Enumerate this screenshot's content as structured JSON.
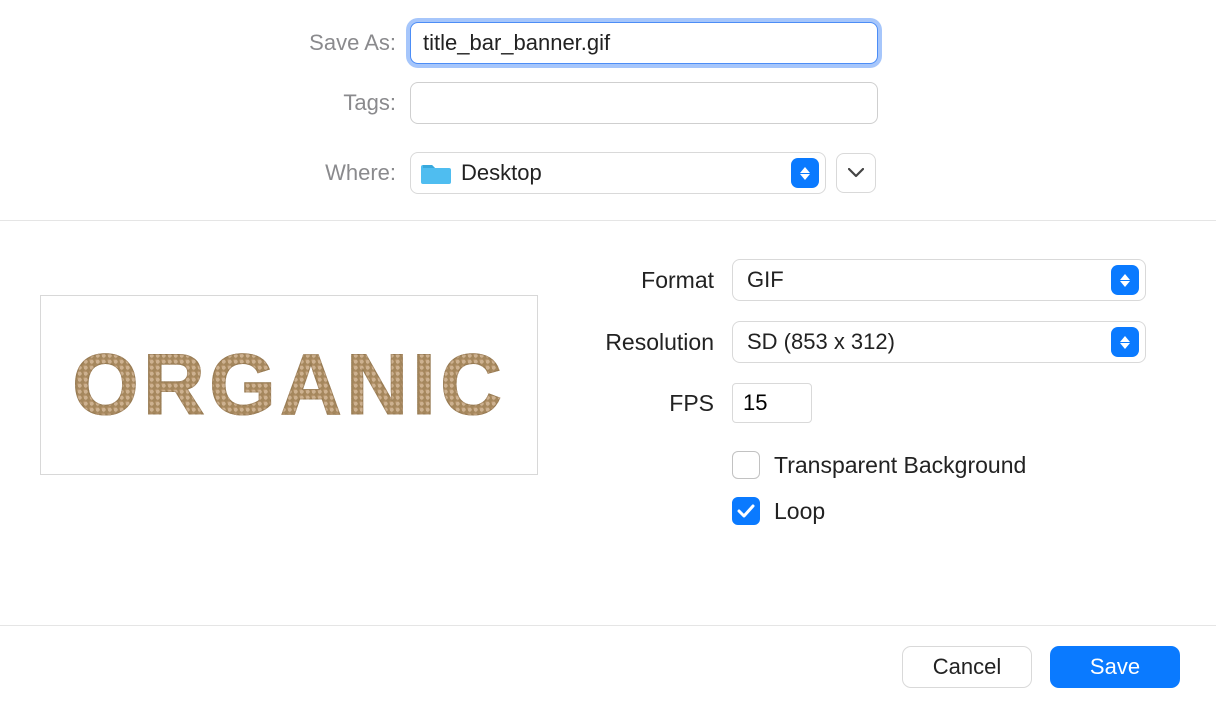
{
  "top": {
    "save_as_label": "Save As:",
    "save_as_value": "title_bar_banner.gif",
    "tags_label": "Tags:",
    "tags_value": "",
    "where_label": "Where:",
    "where_value": "Desktop"
  },
  "preview": {
    "text": "ORGANIC"
  },
  "options": {
    "format_label": "Format",
    "format_value": "GIF",
    "resolution_label": "Resolution",
    "resolution_value": "SD (853 x 312)",
    "fps_label": "FPS",
    "fps_value": "15",
    "transparent_label": "Transparent Background",
    "transparent_checked": false,
    "loop_label": "Loop",
    "loop_checked": true
  },
  "buttons": {
    "cancel": "Cancel",
    "save": "Save"
  }
}
